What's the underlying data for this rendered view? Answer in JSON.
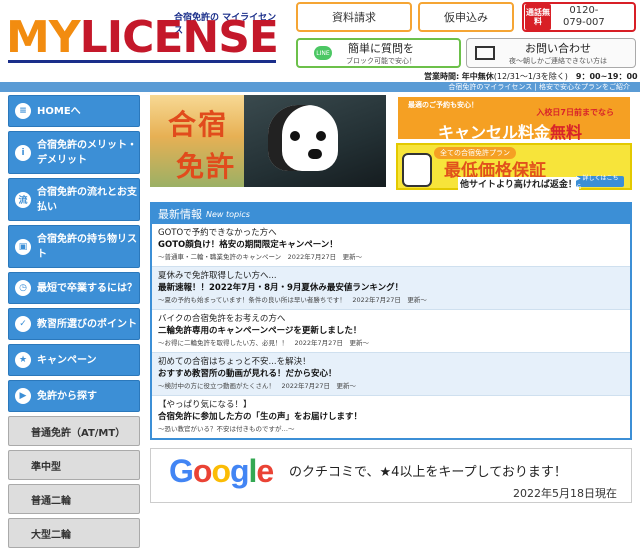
{
  "header": {
    "logo_tag": "合宿免許の マイライセンス",
    "logo_my": "MY",
    "logo_license": "LICENSE",
    "btn_documents": "資料請求",
    "btn_apply": "仮申込み",
    "tel_badge": "通話無料",
    "tel_number_1": "0120-",
    "tel_number_2": "079-007",
    "line_title": "簡単に質問を",
    "line_sub": "ブロック可能で安心！",
    "line_icon_text": "LINE",
    "mail_title": "お問い合わせ",
    "mail_sub": "夜～朝しかご連絡できない方は",
    "hours_label": "営業時間:",
    "hours_days": "年中無休",
    "hours_note": "(12/31～1/3を除く)",
    "hours_time": "9：00~19：00",
    "bluebar_text": "合宿免許のマイライセンス | 格安で安心なプランをご紹介"
  },
  "sidebar": {
    "items": [
      {
        "icon": "≡",
        "label": "HOMEへ"
      },
      {
        "icon": "i",
        "label": "合宿免許のメリット・デメリット"
      },
      {
        "icon": "流",
        "label": "合宿免許の流れとお支払い"
      },
      {
        "icon": "▣",
        "label": "合宿免許の持ち物リスト"
      },
      {
        "icon": "◷",
        "label": "最短で卒業するには？"
      },
      {
        "icon": "✓",
        "label": "教習所選びのポイント"
      },
      {
        "icon": "★",
        "label": "キャンペーン"
      },
      {
        "icon": "▶",
        "label": "免許から探す"
      }
    ],
    "sub_items": [
      "普通免許（AT/MT）",
      "準中型",
      "普通二輪",
      "大型二輪"
    ]
  },
  "banner": {
    "kanji_top": "合宿",
    "kanji_bottom": "免許"
  },
  "promo1": {
    "top": "最適のご予約も安心！",
    "mid": "入校日7日前までなら",
    "main_a": "キャンセル料金",
    "main_b": "無料",
    "button": "▶ 詳しくはこちら"
  },
  "promo2": {
    "top": "全ての合宿免許プラン",
    "main": "最低価格保証",
    "sub": "他サイトより高ければ返金！",
    "button": "▶ 詳しくはこちら"
  },
  "topics": {
    "title": "最新情報",
    "subtitle": "New topics",
    "items": [
      {
        "line1": "GOTOで予約できなかった方へ",
        "line2": "GOTO顔負け！格安の期間限定キャンペーン！",
        "line3": "〜普通車・二輪・職業免許のキャンペーン　2022年7月27日　更新〜"
      },
      {
        "line1": "夏休みで免許取得したい方へ...",
        "line2": "最新速報！！2022年7月・8月・9月夏休み最安値ランキング！",
        "line3": "〜夏の予約も始まっています！条件の良い所は早い者勝ちです！　2022年7月27日　更新〜"
      },
      {
        "line1": "バイクの合宿免許をお考えの方へ",
        "line2": "二輪免許専用のキャンペーンページを更新しました！",
        "line3": "〜お得に二輪免許を取得したい方、必見！！　2022年7月27日　更新〜"
      },
      {
        "line1": "初めての合宿はちょっと不安...を解決！",
        "line2": "おすすめ教習所の動画が見れる！だから安心！",
        "line3": "〜検討中の方に役立つ動画がたくさん！　2022年7月27日　更新〜"
      },
      {
        "line1": "【やっぱり気になる！】",
        "line2": "合宿免許に参加した方の「生の声」をお届けします！",
        "line3": "〜恐い教官がいる？不安は付きものですが…〜"
      }
    ]
  },
  "google": {
    "word_parts": [
      "G",
      "o",
      "o",
      "g",
      "l",
      "e"
    ],
    "message": "のクチコミで、★4以上をキープしております！",
    "date": "2022年5月18日現在"
  }
}
